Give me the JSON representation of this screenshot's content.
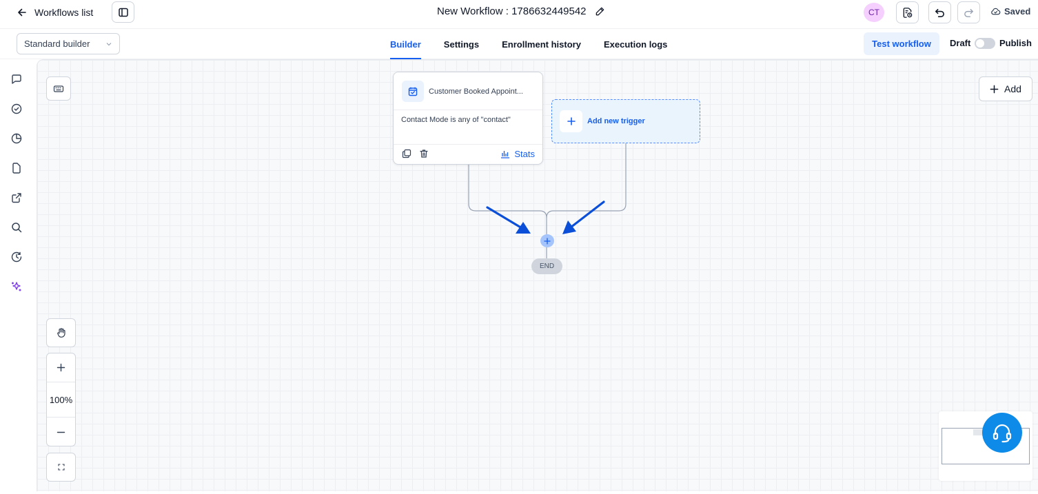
{
  "topbar": {
    "back_label": "Workflows list",
    "workflow_title": "New Workflow : 1786632449542",
    "avatar_initials": "CT",
    "save_status": "Saved"
  },
  "subbar": {
    "builder_select": "Standard builder",
    "tabs": [
      {
        "label": "Builder",
        "active": true
      },
      {
        "label": "Settings",
        "active": false
      },
      {
        "label": "Enrollment history",
        "active": false
      },
      {
        "label": "Execution logs",
        "active": false
      }
    ],
    "test_button": "Test workflow",
    "draft_label": "Draft",
    "publish_label": "Publish",
    "publish_enabled": false
  },
  "rail": {
    "icons": [
      "chat-icon",
      "check-circle-icon",
      "pie-chart-icon",
      "file-icon",
      "external-link-icon",
      "search-icon",
      "history-icon",
      "sparkles-icon"
    ]
  },
  "canvas": {
    "add_button": "Add",
    "zoom_level": "100%",
    "trigger": {
      "title": "Customer Booked Appoint...",
      "condition": "Contact Mode is any of \"contact\"",
      "stats_label": "Stats"
    },
    "add_trigger_label": "Add new trigger",
    "end_label": "END"
  },
  "colors": {
    "accent": "#155eef",
    "arrow": "#0b4fd8",
    "help_button": "#0e8be8",
    "avatar_bg": "#f5d0fe"
  }
}
